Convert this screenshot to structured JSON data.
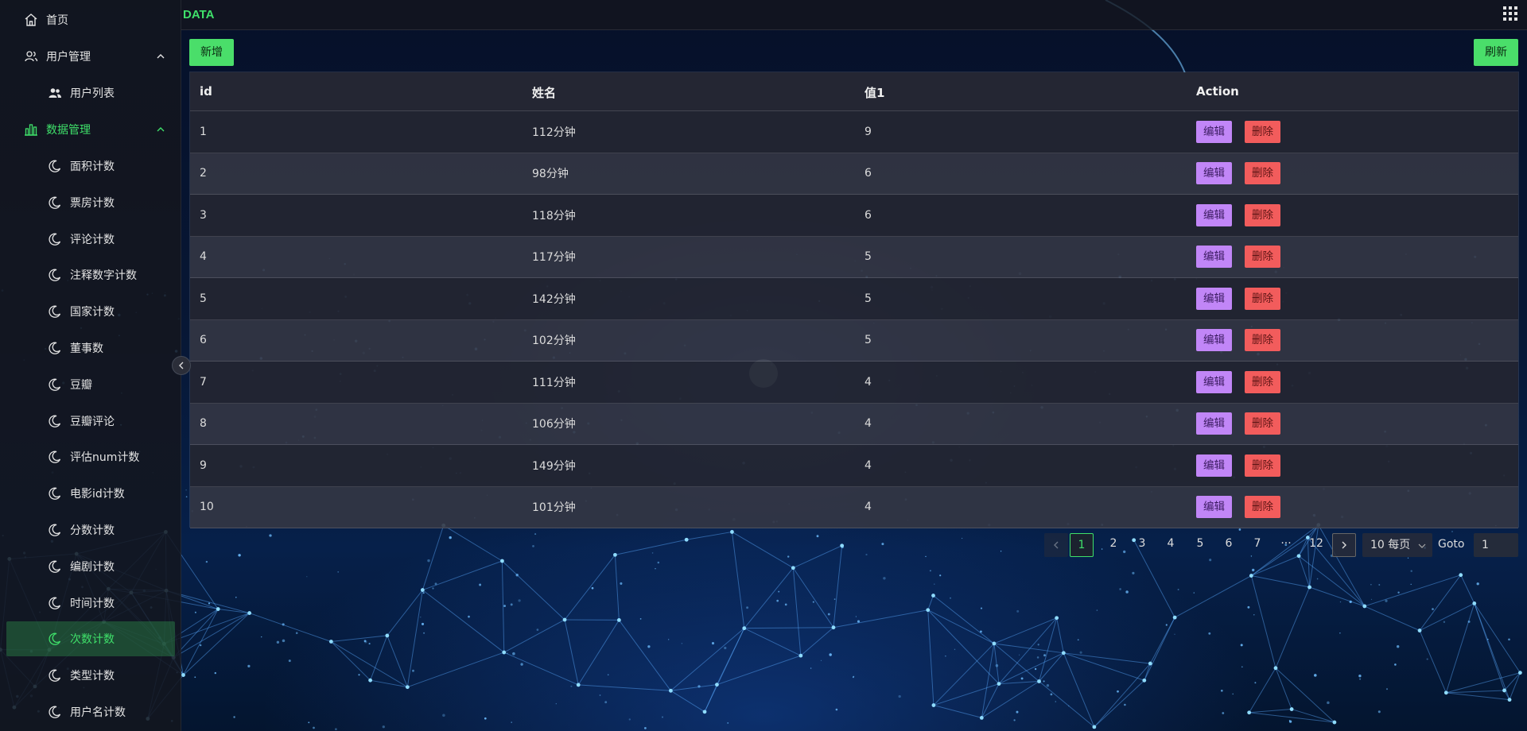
{
  "header": {
    "brand": "DATA",
    "apps_icon": "grid-icon"
  },
  "sidebar": {
    "home": {
      "label": "首页",
      "icon": "home-icon"
    },
    "user_mgmt": {
      "label": "用户管理",
      "icon": "users-outline-icon",
      "expanded": true
    },
    "user_list": {
      "label": "用户列表",
      "icon": "users-solid-icon"
    },
    "data_mgmt": {
      "label": "数据管理",
      "icon": "chart-icon",
      "expanded": true
    },
    "items": [
      {
        "label": "面积计数",
        "icon": "moon-icon"
      },
      {
        "label": "票房计数",
        "icon": "moon-icon"
      },
      {
        "label": "评论计数",
        "icon": "moon-icon"
      },
      {
        "label": "注释数字计数",
        "icon": "moon-icon"
      },
      {
        "label": "国家计数",
        "icon": "moon-icon"
      },
      {
        "label": "董事数",
        "icon": "moon-icon"
      },
      {
        "label": "豆瓣",
        "icon": "moon-icon"
      },
      {
        "label": "豆瓣评论",
        "icon": "moon-icon"
      },
      {
        "label": "评估num计数",
        "icon": "moon-icon"
      },
      {
        "label": "电影id计数",
        "icon": "moon-icon"
      },
      {
        "label": "分数计数",
        "icon": "moon-icon"
      },
      {
        "label": "编剧计数",
        "icon": "moon-icon"
      },
      {
        "label": "时间计数",
        "icon": "moon-icon"
      },
      {
        "label": "次数计数",
        "icon": "moon-icon",
        "selected": true
      },
      {
        "label": "类型计数",
        "icon": "moon-icon"
      },
      {
        "label": "用户名计数",
        "icon": "moon-icon"
      }
    ],
    "accent_color": "#3fe06a"
  },
  "toolbar": {
    "add_label": "新增",
    "refresh_label": "刷新"
  },
  "table": {
    "columns": [
      "id",
      "姓名",
      "值1",
      "Action"
    ],
    "rows": [
      {
        "id": "1",
        "name": "112分钟",
        "value": "9"
      },
      {
        "id": "2",
        "name": "98分钟",
        "value": "6"
      },
      {
        "id": "3",
        "name": "118分钟",
        "value": "6"
      },
      {
        "id": "4",
        "name": "117分钟",
        "value": "5"
      },
      {
        "id": "5",
        "name": "142分钟",
        "value": "5"
      },
      {
        "id": "6",
        "name": "102分钟",
        "value": "5"
      },
      {
        "id": "7",
        "name": "111分钟",
        "value": "4"
      },
      {
        "id": "8",
        "name": "106分钟",
        "value": "4"
      },
      {
        "id": "9",
        "name": "149分钟",
        "value": "4"
      },
      {
        "id": "10",
        "name": "101分钟",
        "value": "4"
      }
    ],
    "edit_label": "编辑",
    "delete_label": "删除",
    "edit_color": "#c186f7",
    "delete_color": "#f25c5c"
  },
  "pagination": {
    "pages": [
      "1",
      "2",
      "3",
      "4",
      "5",
      "6",
      "7",
      "···",
      "12"
    ],
    "current": "1",
    "page_size": "10 每页",
    "goto_label": "Goto",
    "goto_value": "1"
  }
}
